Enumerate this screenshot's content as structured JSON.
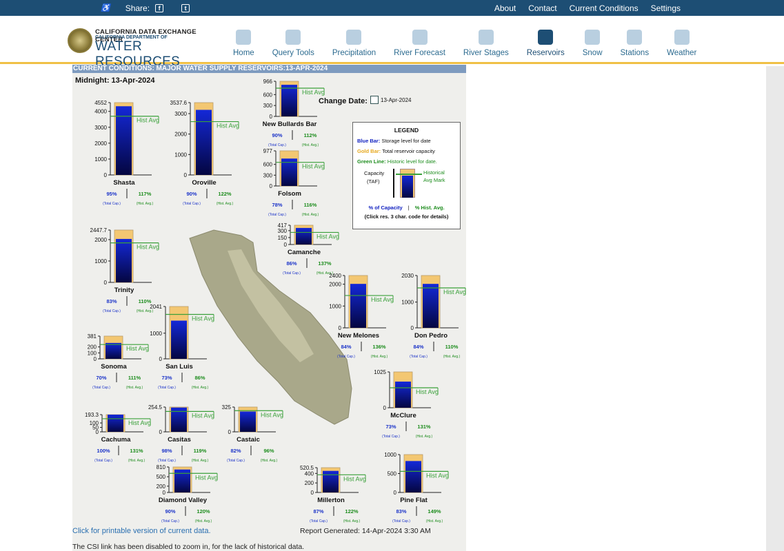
{
  "topbar": {
    "share_label": "Share:",
    "links": [
      "About",
      "Contact",
      "Current Conditions",
      "Settings"
    ]
  },
  "logo": {
    "line1": "CALIFORNIA DATA EXCHANGE CENTER",
    "line2": "CALIFORNIA DEPARTMENT OF",
    "line3": "WATER RESOURCES"
  },
  "nav": [
    {
      "label": "Home",
      "icon": "home-icon"
    },
    {
      "label": "Query Tools",
      "icon": "gears-icon"
    },
    {
      "label": "Precipitation",
      "icon": "cloud-rain-icon"
    },
    {
      "label": "River Forecast",
      "icon": "river-forecast-icon"
    },
    {
      "label": "River Stages",
      "icon": "river-stages-icon"
    },
    {
      "label": "Reservoirs",
      "icon": "dam-icon"
    },
    {
      "label": "Snow",
      "icon": "snowflake-icon"
    },
    {
      "label": "Stations",
      "icon": "tools-icon"
    },
    {
      "label": "Weather",
      "icon": "cloud-upload-icon"
    }
  ],
  "active_nav": "Reservoirs",
  "panel": {
    "title": "CURRENT CONDITIONS: MAJOR WATER SUPPLY RESERVOIRS:13-APR-2024",
    "midnight": "Midnight: 13-Apr-2024",
    "change_label": "Change Date:",
    "change_date": "13-Apr-2024"
  },
  "legend": {
    "title": "LEGEND",
    "blue_bar_label": "Blue Bar:",
    "blue_bar_text": "Storage level for date",
    "gold_bar_label": "Gold Bar:",
    "gold_bar_text": "Total reservoir capacity",
    "green_line_label": "Green Line:",
    "green_line_text": "Historic level for date.",
    "capacity": "Capacity",
    "taf": "(TAF)",
    "hist_mark_1": "Historical",
    "hist_mark_2": "Avg Mark",
    "pct_cap": "% of Capacity",
    "sep": "|",
    "pct_hist": "% Hist. Avg.",
    "click_note": "(Click res. 3 char. code for details)"
  },
  "labels": {
    "hist_avg": "Hist Avg",
    "total_cap": "(Total Cap.)",
    "hist_avg_small": "(Hist. Avg.)"
  },
  "chart_data": {
    "type": "bar",
    "title": "CURRENT CONDITIONS: MAJOR WATER SUPPLY RESERVOIRS:13-APR-2024",
    "units": "TAF",
    "reservoirs": [
      {
        "name": "Shasta",
        "capacity": 4552,
        "ticks": [
          "4552",
          "4000",
          "3000",
          "2000",
          "1000",
          "0"
        ],
        "pct_capacity": "95%",
        "pct_hist": "117%"
      },
      {
        "name": "Oroville",
        "capacity": 3537.6,
        "ticks": [
          "3537.6",
          "3000",
          "2000",
          "1000",
          "0"
        ],
        "pct_capacity": "90%",
        "pct_hist": "122%"
      },
      {
        "name": "New Bullards Bar",
        "capacity": 966,
        "ticks": [
          "966",
          "600",
          "300",
          "0"
        ],
        "pct_capacity": "90%",
        "pct_hist": "112%"
      },
      {
        "name": "Folsom",
        "capacity": 977,
        "ticks": [
          "977",
          "600",
          "300",
          "0"
        ],
        "pct_capacity": "78%",
        "pct_hist": "116%"
      },
      {
        "name": "Camanche",
        "capacity": 417,
        "ticks": [
          "417",
          "300",
          "150",
          "0"
        ],
        "pct_capacity": "86%",
        "pct_hist": "137%"
      },
      {
        "name": "Trinity",
        "capacity": 2447.7,
        "ticks": [
          "2447.7",
          "2000",
          "1000",
          "0"
        ],
        "pct_capacity": "83%",
        "pct_hist": "110%"
      },
      {
        "name": "San Luis",
        "capacity": 2041,
        "ticks": [
          "2041",
          "1000",
          "0"
        ],
        "pct_capacity": "73%",
        "pct_hist": "86%"
      },
      {
        "name": "Sonoma",
        "capacity": 381,
        "ticks": [
          "381",
          "200",
          "100",
          "0"
        ],
        "pct_capacity": "70%",
        "pct_hist": "111%"
      },
      {
        "name": "New Melones",
        "capacity": 2400,
        "ticks": [
          "2400",
          "2000",
          "1000",
          "0"
        ],
        "pct_capacity": "84%",
        "pct_hist": "136%"
      },
      {
        "name": "Don Pedro",
        "capacity": 2030,
        "ticks": [
          "2030",
          "1000",
          "0"
        ],
        "pct_capacity": "84%",
        "pct_hist": "110%"
      },
      {
        "name": "McClure",
        "capacity": 1025,
        "ticks": [
          "1025",
          "0"
        ],
        "pct_capacity": "73%",
        "pct_hist": "131%"
      },
      {
        "name": "Cachuma",
        "capacity": 193.3,
        "ticks": [
          "193.3",
          "100",
          "50",
          "0"
        ],
        "pct_capacity": "100%",
        "pct_hist": "131%"
      },
      {
        "name": "Casitas",
        "capacity": 254.5,
        "ticks": [
          "254.5",
          "0"
        ],
        "pct_capacity": "98%",
        "pct_hist": "119%"
      },
      {
        "name": "Castaic",
        "capacity": 325,
        "ticks": [
          "325",
          "0"
        ],
        "pct_capacity": "82%",
        "pct_hist": "96%"
      },
      {
        "name": "Diamond Valley",
        "capacity": 810,
        "ticks": [
          "810",
          "500",
          "200",
          "0"
        ],
        "pct_capacity": "90%",
        "pct_hist": "120%"
      },
      {
        "name": "Millerton",
        "capacity": 520.5,
        "ticks": [
          "520.5",
          "400",
          "200",
          "0"
        ],
        "pct_capacity": "87%",
        "pct_hist": "122%"
      },
      {
        "name": "Pine Flat",
        "capacity": 1000,
        "ticks": [
          "1000",
          "500",
          "0"
        ],
        "pct_capacity": "83%",
        "pct_hist": "149%"
      }
    ]
  },
  "footer": {
    "print_link": "Click for printable version of current data.",
    "report": "Report Generated: 14-Apr-2024 3:30 AM",
    "csi_note": "The CSI link has been disabled to zoom in, for the lack of historical data."
  },
  "colors": {
    "topbar": "#1d4e74",
    "gold": "#f3c772",
    "blue_top": "#1428d8",
    "blue_bottom": "#040640",
    "green_line": "#3aa03a",
    "pct_blue": "#1a32c8",
    "pct_green": "#1c8c1c"
  }
}
